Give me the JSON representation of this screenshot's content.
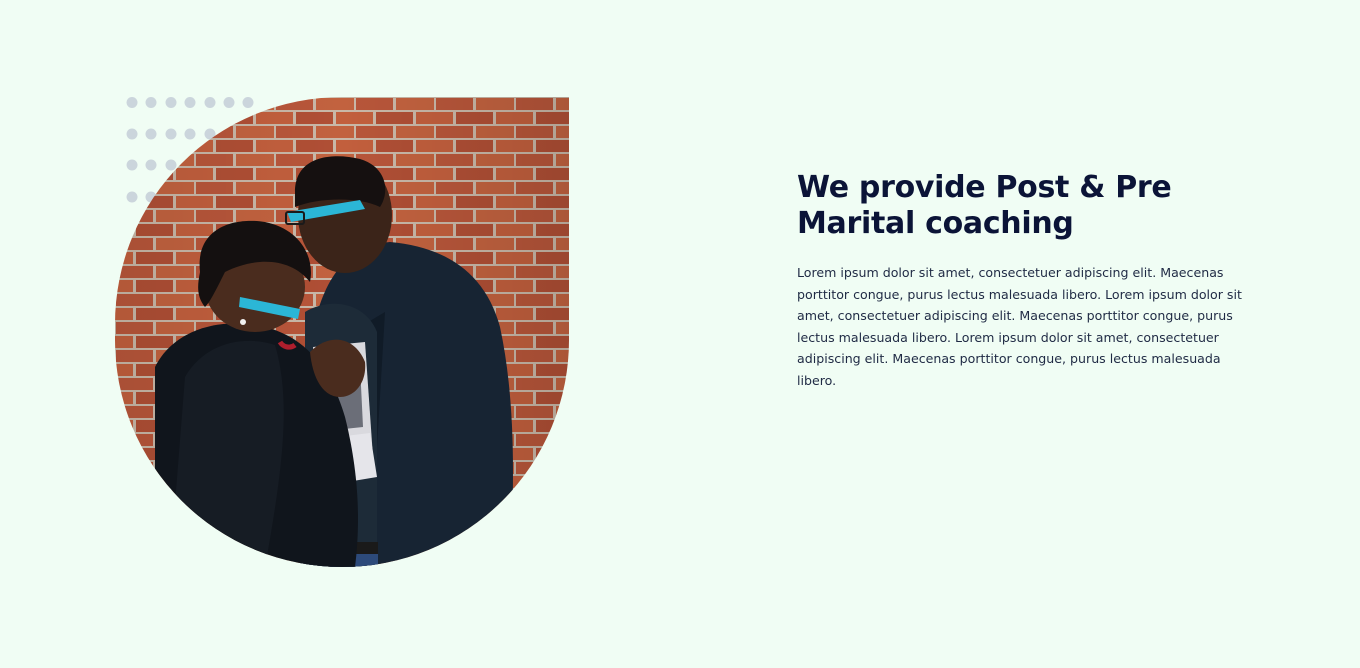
{
  "about": {
    "heading": "We provide Post & Pre Marital coaching",
    "paragraph": "Lorem ipsum dolor sit amet, consectetuer adipiscing elit. Maecenas porttitor congue, purus lectus malesuada libero. Lorem ipsum dolor sit amet, consectetuer adipiscing elit. Maecenas porttitor congue, purus lectus malesuada libero. Lorem ipsum dolor sit amet, consectetuer adipiscing elit. Maecenas porttitor congue, purus lectus malesuada libero.",
    "photo": {
      "icon": "couple-photo"
    }
  },
  "colors": {
    "background": "#f0fdf4",
    "heading": "#0b1437",
    "text": "#1f2a44",
    "dots": "#cbd5dc",
    "brick": "#b8563a",
    "mortar": "#c9b8a8"
  }
}
